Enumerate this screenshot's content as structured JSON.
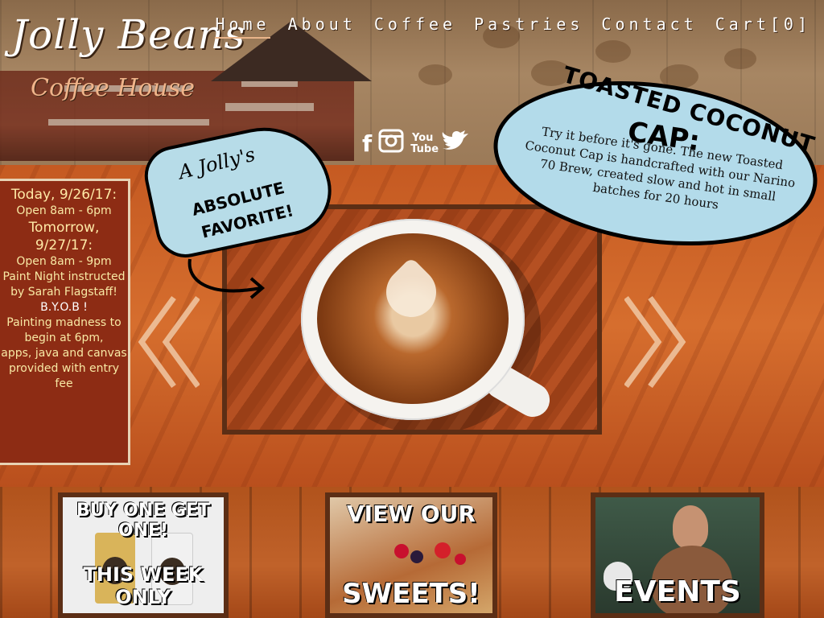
{
  "brand": {
    "title": "Jolly Beans",
    "subtitle": "Coffee House"
  },
  "nav": {
    "items": [
      "Home",
      "About",
      "Coffee",
      "Pastries",
      "Contact",
      "Cart[0]"
    ],
    "active": "Home"
  },
  "social": {
    "icons": [
      "facebook-icon",
      "instagram-icon",
      "youtube-icon",
      "twitter-icon"
    ],
    "youtube_label": "You Tube"
  },
  "hours": {
    "today_label": "Today, 9/26/17:",
    "today_hours": "Open 8am - 6pm",
    "tomorrow_label": "Tomorrow, 9/27/17:",
    "tomorrow_hours": "Open 8am - 9pm",
    "event_line1": "Paint Night instructed",
    "event_line2": "by Sarah Flagstaff!",
    "byob": "B.Y.O.B !",
    "details_line1": "Painting madness to",
    "details_line2": "begin at 6pm,",
    "details_line3": "apps, java and canvas",
    "details_line4": "provided with entry",
    "details_line5": "fee"
  },
  "favorite_bubble": {
    "line1": "A Jolly's",
    "line2": "ABSOLUTE",
    "line3": "FAVORITE!"
  },
  "feature_bubble": {
    "title_line1": "TOASTED COCONUT",
    "title_line2": "CAP:",
    "description": "Try it before it's gone. The new Toasted Coconut Cap is handcrafted with our Narino 70 Brew, created slow and hot in small batches for 20 hours"
  },
  "carousel": {
    "prev_icon": "chevron-left-icon",
    "next_icon": "chevron-right-icon"
  },
  "promos": {
    "bogo_top": "BUY ONE   GET ONE!",
    "bogo_bottom": "THIS WEEK ONLY",
    "sweets_top": "VIEW OUR",
    "sweets_bottom": "SWEETS!",
    "events": "EVENTS"
  },
  "colors": {
    "accent_text": "#f8e9a4",
    "bubble_blue": "#b3dbea",
    "panel_red": "#8d2c14",
    "wood_orange": "#c55a22"
  }
}
